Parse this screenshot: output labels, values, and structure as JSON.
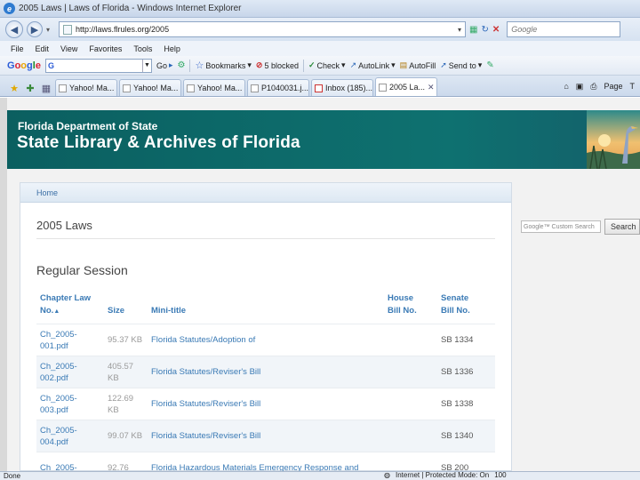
{
  "window": {
    "title": "2005 Laws | Laws of Florida - Windows Internet Explorer"
  },
  "address": {
    "url": "http://laws.flrules.org/2005",
    "search_placeholder": "Google"
  },
  "menu": [
    "File",
    "Edit",
    "View",
    "Favorites",
    "Tools",
    "Help"
  ],
  "google_toolbar": {
    "logo": "Google",
    "search_prefix": "G",
    "go": "Go",
    "bookmarks": "Bookmarks",
    "blocked": "5 blocked",
    "check": "Check",
    "autolink": "AutoLink",
    "autofill": "AutoFill",
    "send_to": "Send to"
  },
  "tabs": [
    {
      "label": "Yahoo! Ma..."
    },
    {
      "label": "Yahoo! Ma..."
    },
    {
      "label": "Yahoo! Ma..."
    },
    {
      "label": "P1040031.j..."
    },
    {
      "label": "Inbox (185)..."
    },
    {
      "label": "2005 La...",
      "active": true
    }
  ],
  "tab_tools": {
    "page": "Page",
    "tools": "T"
  },
  "banner": {
    "department": "Florida Department of State",
    "library": "State Library & Archives of Florida"
  },
  "breadcrumb": "Home",
  "page_title": "2005 Laws",
  "section_title": "Regular Session",
  "table": {
    "headers": {
      "chapter_law": "Chapter Law",
      "chapter_no": "No.",
      "size": "Size",
      "mini_title": "Mini-title",
      "house": "House",
      "house_bill": "Bill No.",
      "senate": "Senate",
      "senate_bill": "Bill No."
    },
    "rows": [
      {
        "chapter": "Ch_2005-001.pdf",
        "size": "95.37 KB",
        "title": "Florida Statutes/Adoption of",
        "house": "",
        "senate": "SB 1334"
      },
      {
        "chapter": "Ch_2005-002.pdf",
        "size": "405.57 KB",
        "title": "Florida Statutes/Reviser's Bill",
        "house": "",
        "senate": "SB 1336"
      },
      {
        "chapter": "Ch_2005-003.pdf",
        "size": "122.69 KB",
        "title": "Florida Statutes/Reviser's Bill",
        "house": "",
        "senate": "SB 1338"
      },
      {
        "chapter": "Ch_2005-004.pdf",
        "size": "99.07 KB",
        "title": "Florida Statutes/Reviser's Bill",
        "house": "",
        "senate": "SB 1340"
      },
      {
        "chapter": "Ch_2005-",
        "size": "92.76",
        "title": "Florida Hazardous Materials Emergency Response and",
        "house": "",
        "senate": "SB 200"
      }
    ]
  },
  "search": {
    "placeholder": "Google™ Custom Search",
    "button": "Search"
  },
  "status": {
    "left": "Done",
    "zone": "Internet | Protected Mode: On",
    "zoom": "100"
  }
}
